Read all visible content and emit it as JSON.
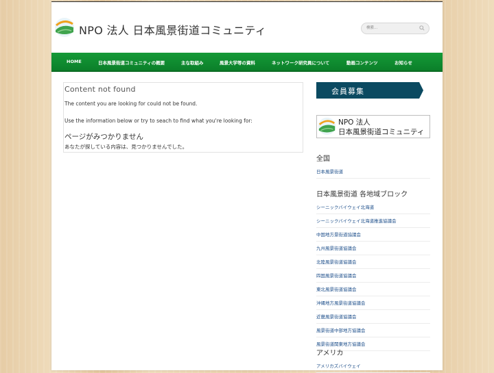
{
  "header": {
    "site_title": "NPO 法人 日本風景街道コミュニティ",
    "search_placeholder": "検索..."
  },
  "nav": {
    "items": [
      {
        "label": "HOME"
      },
      {
        "label": "日本風景街道コミュニティの概要"
      },
      {
        "label": "主な取組み"
      },
      {
        "label": "風景大学等の資料"
      },
      {
        "label": "ネットワーク研究員について"
      },
      {
        "label": "動画コンテンツ"
      },
      {
        "label": "お知らせ"
      }
    ]
  },
  "main": {
    "title": "Content not found",
    "para1": "The content you are looking for could not be found.",
    "para2": "Use the information below or try to seach to find what you're looking for:",
    "jp_title": "ページがみつかりません",
    "jp_para": "あなたが探している内容は、見つかりませんでした。"
  },
  "sidebar": {
    "member_banner": "会員募集",
    "npo_banner_line1": "NPO 法人",
    "npo_banner_line2": "日本風景街道コミュニティ",
    "sections": [
      {
        "title": "全国",
        "links": [
          "日本風景街道"
        ]
      },
      {
        "title": "日本風景街道 各地域ブロック",
        "links": [
          "シーニックバイウェイ北海道",
          "シーニックバイウェイ北海道推進協議会",
          "中国地方景街道協議会",
          "九州風景街道協議会",
          "北陸風景街道協議会",
          "四国風景街道協議会",
          "東北風景街道協議会",
          "沖縄地方風景街道協議会",
          "近畿風景街道協議会",
          "風景街道中部地方協議会",
          "風景街道関東地方協議会"
        ]
      },
      {
        "title": "アメリカ",
        "links": [
          "アメリカズバイウェイ"
        ]
      }
    ]
  },
  "colors": {
    "nav_green": "#0f8c31",
    "banner_navy": "#0b4a61",
    "link_blue": "#1c4e8a"
  }
}
